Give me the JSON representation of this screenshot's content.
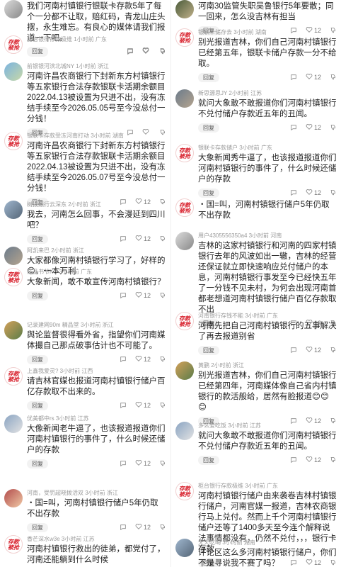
{
  "left": [
    {
      "id": "l0",
      "meta": "",
      "text": "我们河南村镇银行银联卡存款5年了每个一分都不让取，赔红码，青龙山庄头摆，永生难忘。有良心的媒体请我们报道一下吧。",
      "reply": "回复",
      "likes": "",
      "avatar": "photo8"
    },
    {
      "id": "l1",
      "meta": "韶台银行存款极维 1小时前 广东",
      "text": "",
      "reply": "回复",
      "likes": "",
      "avatar": "stamp"
    },
    {
      "id": "l2",
      "meta": "前银银河滨北城NY 1小时前 浙江",
      "text": "河南许昌农商银行下封新东方村镇银行等五家银行合法存款银联卡活期余额目2022.04.13被设置为只进不出，没有冻结手续至今2026.05.05号至今没总付一分钱！",
      "reply": "回复",
      "likes": "",
      "avatar": "photo"
    },
    {
      "id": "l3",
      "meta": "银联卡存款受冻河南打动 3小时前 湖南",
      "text": "河南许昌农商银行下封新东方村镇银行等五家银行合法存款银联卡活期余额目2022.04.13被设置为只进不出，没有冻结手续至今2026.05.07号至今没总付一分钱！",
      "reply": "回复",
      "likes": "12",
      "avatar": "stamp"
    },
    {
      "id": "l4",
      "meta": "树拨巅行云深东 2小时前 浙江",
      "text": "我去，河南怎么回事，不会漫延到四川吧？",
      "reply": "回复",
      "likes": "12",
      "avatar": "photo6"
    },
    {
      "id": "l5",
      "meta": "阿凯来巴 2小时前 浙江",
      "text": "大家都像河南村镇银行学习了，好样的😊。一本万利",
      "reply": "",
      "likes": "",
      "avatar": "photo2"
    },
    {
      "id": "l6",
      "meta": "商品书爷KU 3小时前 广东",
      "text": "大象新闻，敢不敢宣传河南村镇银行？",
      "reply": "回复",
      "likes": "12",
      "avatar": "stamp"
    },
    {
      "id": "l7",
      "meta": "记录建网90m 精品堂 3小时前 浙江",
      "text": "舆论监督很得看外省，指望你们河南媒体撮自己那点破事估计也不可能了。",
      "reply": "回复",
      "likes": "12",
      "avatar": "photo3",
      "badge": "精品堂"
    },
    {
      "id": "l8",
      "meta": "上鑫我爱灵? 3小时前 江西",
      "text": "请吉林官媒也报道河南村镇银行储户百亿存款取不出来的。",
      "reply": "回复",
      "likes": "12",
      "avatar": "stamp"
    },
    {
      "id": "l9",
      "meta": "优美都中rs 3小时前 江苏",
      "text": "大像新闻老牛逼了，也该报道报道你们河南村镇银行的事件了，什么时候还储户的存款",
      "reply": "回复",
      "likes": "12",
      "avatar": "photo4"
    },
    {
      "id": "l10",
      "meta": "河南，受罚超晓拨活双 3小时前 浙江",
      "text": "・国=叫，河南村镇银行储户5年仍取不出存款",
      "reply": "回复",
      "likes": "12",
      "avatar": "photo5"
    },
    {
      "id": "l11",
      "meta": "香芒深水w3e 3小时前 江苏",
      "text": "河南村镇银行救出的徒弟，都党付了，河南还能躺到什么时候",
      "reply": "",
      "likes": "",
      "avatar": "stamp"
    }
  ],
  "right": [
    {
      "id": "r0",
      "meta": "",
      "text": "河南30监管失职吴鲁银行5年要散；同一回来，怎么没吉林有担当",
      "reply": "回复",
      "likes": "12",
      "avatar": "photo7"
    },
    {
      "id": "r1",
      "meta": "银联卡储存去 3小时前 湖南",
      "text": "别光报道吉林，你们自己河南村镇银行已经第五年，银联卡储户存款一分不给取。",
      "reply": "回复",
      "likes": "12",
      "avatar": "stamp"
    },
    {
      "id": "r2",
      "meta": "新思源思JY 2小时前 江苏",
      "text": "就问大象敢不敢报道你们河南村镇银行不兑付储户存款近五年的丑闻。",
      "reply": "回复",
      "likes": "12",
      "avatar": "photo2"
    },
    {
      "id": "r3",
      "meta": "银联卡存款储户 3小时前 广东",
      "text": "大象新闻秀牛逼了，也该报道报道你们河南村镇银行的事件了，什么时候还储户的存款",
      "reply": "回复",
      "likes": "12",
      "avatar": "stamp"
    },
    {
      "id": "r4",
      "meta": "",
      "text": "・国=叫，河南村镇银行储户5年仍取不出存款",
      "reply": "",
      "likes": "",
      "avatar": "stamp"
    },
    {
      "id": "r5",
      "meta": "用户4305556350a4 3小时前 河南",
      "text": "吉林的这家村镇银行和河南的四家村镇银行去年的风波如出一辙，吉林的经营还保证就立即快速响应兑付储户的本息，河南村镇银行事发至今已经快五年了一分钱不见未村，为何会出现河南首都老想道河南村镇银行储户百亿存款取不出",
      "reply": "回复",
      "likes": "12",
      "avatar": "photo8"
    },
    {
      "id": "r6",
      "meta": "河南银行存钱不能 3小时前 广东",
      "text": "河南先把自己河南村镇银行的五事解决了再去报道别省",
      "reply": "回复",
      "likes": "12",
      "avatar": "stamp"
    },
    {
      "id": "r7",
      "meta": "黄鹂 2小时前 浙江",
      "text": "别光报道吉林，你们自己河南村镇银行已经第四年，河南媒体像自己省内村镇银行的款活般给，居然有脸报道😊😊😊",
      "reply": "回复",
      "likes": "12",
      "avatar": "photo3"
    },
    {
      "id": "r8",
      "meta": "多么爱吃饭 3小时前 江苏",
      "text": "就问大象敢不敢报道你们河南村镇银行不兑付储户存款近五年的丑闻。",
      "reply": "回复",
      "likes": "12",
      "avatar": "photo4"
    },
    {
      "id": "r9",
      "meta": "柜台银行存款极维 3小时前 广东",
      "text": "河南村镇银行储户由来袭卷吉林村镇银行储户，河南官媒一报道，吉林农商银行马上兑付。然而上千个河南村镇银行储户还等了1400多天至今连个解释说法事情都没有，仍然不兑付，，，银行卡存款",
      "reply": "回复",
      "likes": "12",
      "avatar": "stamp"
    },
    {
      "id": "r10",
      "meta": "天天吃喝 3小时前 湖南",
      "text": "评论区这么多河南村镇银行储户，你们不是寻说我不赛了吗？",
      "reply": "",
      "likes": "",
      "avatar": "photo6"
    }
  ],
  "icons": {
    "comment": "comment-icon",
    "like": "heart-icon",
    "dislike": "thumbs-down-icon"
  },
  "stamp": {
    "line1": "存款",
    "line2": "被抢"
  }
}
